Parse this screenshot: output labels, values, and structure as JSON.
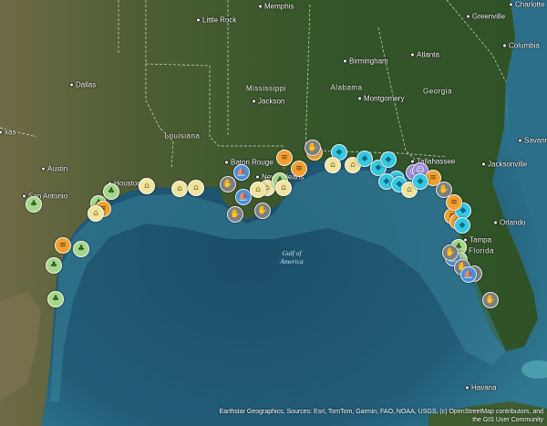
{
  "map": {
    "colors": {
      "water_deep": "#1e5670",
      "water_shallow": "#3f8fa6",
      "land": "#3b5a2b",
      "land_dry": "#7a7a52",
      "marker_tan": "#f1e3a0",
      "marker_orange": "#f0a030",
      "marker_cyan": "#35c8e0",
      "marker_green": "#a6d68a",
      "marker_gray": "#7b7f83",
      "marker_blue": "#4a8fd8",
      "marker_purple": "#9a8ad8"
    },
    "state_labels": [
      {
        "name": "Louisiana"
      },
      {
        "name": "Mississippi"
      },
      {
        "name": "Alabama"
      },
      {
        "name": "Georgia"
      },
      {
        "name": "Florida"
      }
    ],
    "cities": [
      {
        "name": "Memphis"
      },
      {
        "name": "Greenville"
      },
      {
        "name": "Charlotte"
      },
      {
        "name": "Little Rock"
      },
      {
        "name": "Columbia"
      },
      {
        "name": "Dallas"
      },
      {
        "name": "Birmingham"
      },
      {
        "name": "Atlanta"
      },
      {
        "name": "Jackson"
      },
      {
        "name": "Montgomery"
      },
      {
        "name": "Austin"
      },
      {
        "name": "San Antonio"
      },
      {
        "name": "Houston"
      },
      {
        "name": "Baton Rouge"
      },
      {
        "name": "New Orleans"
      },
      {
        "name": "Tallahassee"
      },
      {
        "name": "Jacksonville"
      },
      {
        "name": "Orlando"
      },
      {
        "name": "Tampa"
      },
      {
        "name": "Havana"
      },
      {
        "name": "Savannah"
      },
      {
        "name": "xas"
      }
    ],
    "water_label": "Gulf of\nAmerica",
    "attribution": "Earthstar Geographics, Sources: Esri, TomTom, Garmin, FAO, NOAA, USGS, (c) OpenStreetMap contributors, and the GIS User Community"
  },
  "markers": [
    {
      "kind": "green",
      "icon": "tree-icon"
    },
    {
      "kind": "green",
      "icon": "tree-icon"
    },
    {
      "kind": "green",
      "icon": "tree-icon"
    },
    {
      "kind": "green",
      "icon": "tree-icon"
    },
    {
      "kind": "orange",
      "icon": "stripes-icon"
    },
    {
      "kind": "green",
      "icon": "tree-icon"
    },
    {
      "kind": "tan",
      "icon": "building-icon"
    },
    {
      "kind": "orange",
      "icon": "stripes-icon"
    },
    {
      "kind": "green",
      "icon": "tree-icon"
    },
    {
      "kind": "tan",
      "icon": "building-icon"
    },
    {
      "kind": "tan",
      "icon": "building-icon"
    },
    {
      "kind": "tan",
      "icon": "building-icon"
    },
    {
      "kind": "tan",
      "icon": "building-icon"
    },
    {
      "kind": "gray",
      "icon": "hand-icon"
    },
    {
      "kind": "blue",
      "icon": "boat-icon"
    },
    {
      "kind": "blue",
      "icon": "boat-icon"
    },
    {
      "kind": "tan",
      "icon": "building-icon"
    },
    {
      "kind": "green",
      "icon": "tree-icon"
    },
    {
      "kind": "tan",
      "icon": "building-icon"
    },
    {
      "kind": "gray",
      "icon": "hand-icon"
    },
    {
      "kind": "gray",
      "icon": "hand-icon"
    },
    {
      "kind": "orange",
      "icon": "stripes-icon"
    },
    {
      "kind": "orange",
      "icon": "stripes-icon"
    },
    {
      "kind": "gray",
      "icon": "hand-icon"
    },
    {
      "kind": "tan",
      "icon": "building-icon"
    },
    {
      "kind": "orange",
      "icon": "stripes-icon"
    },
    {
      "kind": "cyan",
      "icon": "drop-icon"
    },
    {
      "kind": "cyan",
      "icon": "drop-icon"
    },
    {
      "kind": "tan",
      "icon": "building-icon"
    },
    {
      "kind": "cyan",
      "icon": "drop-icon"
    },
    {
      "kind": "cyan",
      "icon": "drop-icon"
    },
    {
      "kind": "cyan",
      "icon": "drop-icon"
    },
    {
      "kind": "cyan",
      "icon": "drop-icon"
    },
    {
      "kind": "purple",
      "icon": "people-icon"
    },
    {
      "kind": "purple",
      "icon": "people-icon"
    },
    {
      "kind": "cyan",
      "icon": "drop-icon"
    },
    {
      "kind": "orange",
      "icon": "stripes-icon"
    },
    {
      "kind": "tan",
      "icon": "building-icon"
    },
    {
      "kind": "cyan",
      "icon": "drop-icon"
    },
    {
      "kind": "orange",
      "icon": "stripes-icon"
    },
    {
      "kind": "gray",
      "icon": "hand-icon"
    },
    {
      "kind": "orange",
      "icon": "stripes-icon"
    },
    {
      "kind": "cyan",
      "icon": "drop-icon"
    },
    {
      "kind": "orange",
      "icon": "stripes-icon"
    },
    {
      "kind": "cyan",
      "icon": "drop-icon"
    },
    {
      "kind": "green",
      "icon": "tree-icon"
    },
    {
      "kind": "green",
      "icon": "tree-icon"
    },
    {
      "kind": "blue",
      "icon": "boat-icon"
    },
    {
      "kind": "gray",
      "icon": "hand-icon"
    },
    {
      "kind": "gray",
      "icon": "hand-icon"
    },
    {
      "kind": "gray",
      "icon": "hand-icon"
    },
    {
      "kind": "gray",
      "icon": "hand-icon"
    },
    {
      "kind": "blue",
      "icon": "boat-icon"
    }
  ]
}
